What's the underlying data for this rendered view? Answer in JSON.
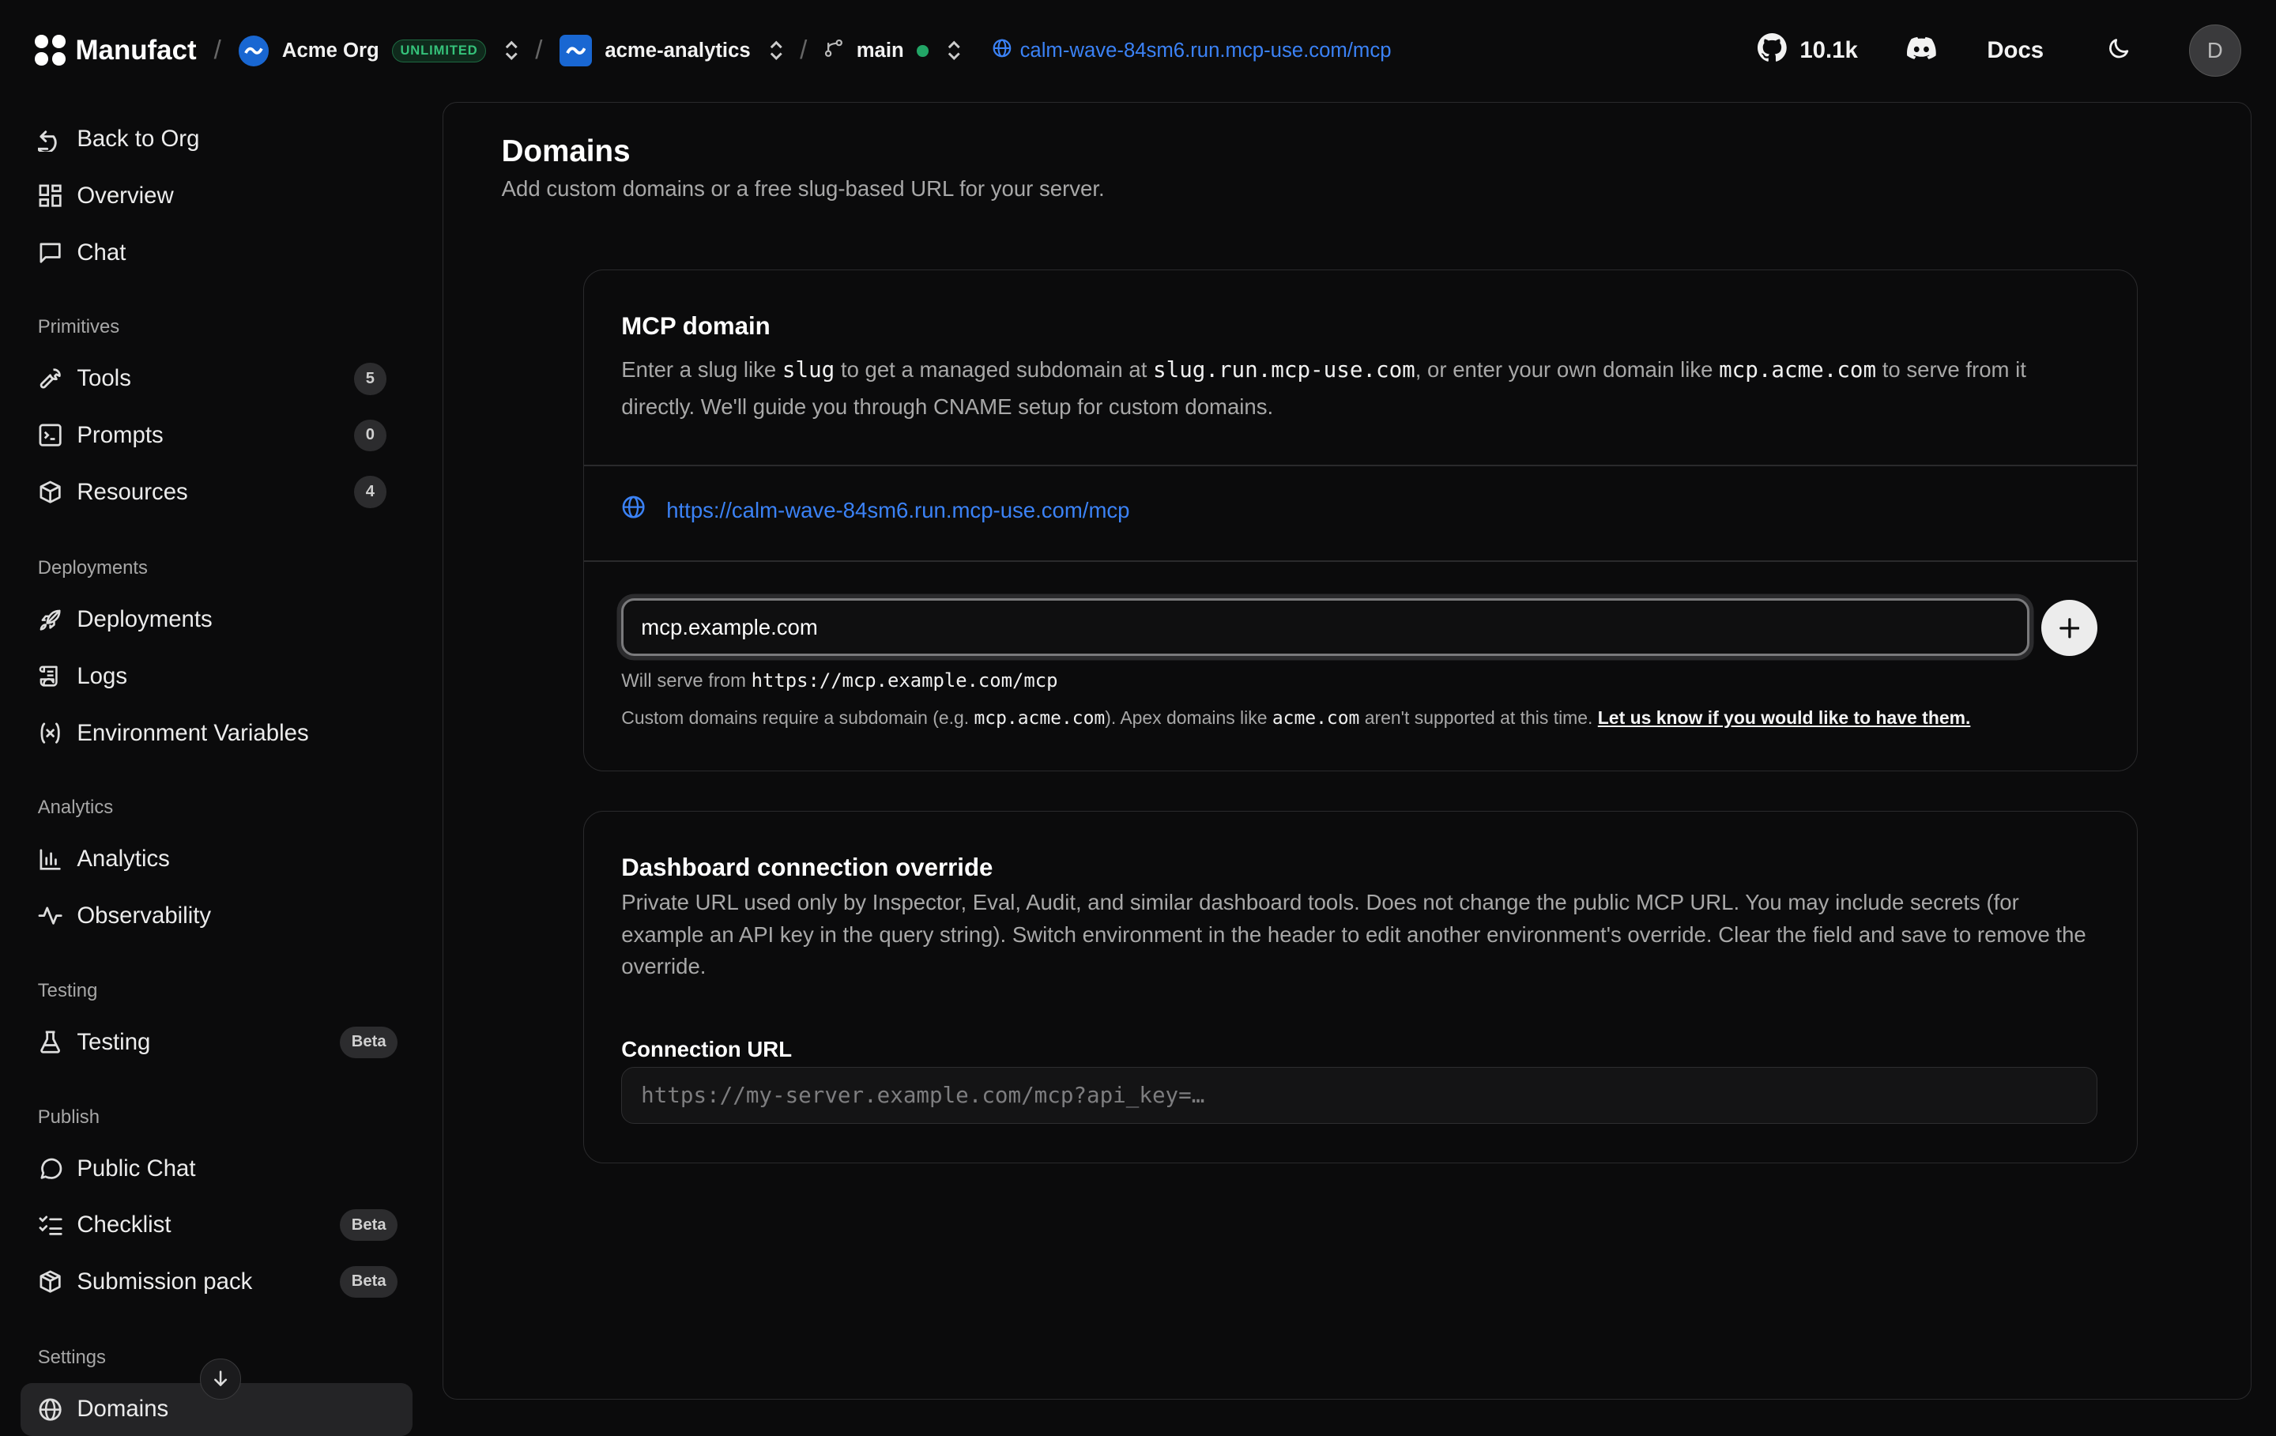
{
  "topbar": {
    "brand": "Manufact",
    "org": {
      "name": "Acme Org",
      "badge": "UNLIMITED"
    },
    "project": "acme-analytics",
    "branch": "main",
    "server_url": "calm-wave-84sm6.run.mcp-use.com/mcp",
    "github_stars": "10.1k",
    "docs_label": "Docs",
    "avatar_initial": "D"
  },
  "sidebar": {
    "back": "Back to Org",
    "overview": "Overview",
    "chat": "Chat",
    "sections": {
      "primitives": "Primitives",
      "deployments": "Deployments",
      "analytics": "Analytics",
      "testing": "Testing",
      "publish": "Publish",
      "settings": "Settings"
    },
    "items": {
      "tools": {
        "label": "Tools",
        "count": "5"
      },
      "prompts": {
        "label": "Prompts",
        "count": "0"
      },
      "resources": {
        "label": "Resources",
        "count": "4"
      },
      "deployments": "Deployments",
      "logs": "Logs",
      "env_vars": "Environment Variables",
      "analytics": "Analytics",
      "observability": "Observability",
      "testing": {
        "label": "Testing",
        "badge": "Beta"
      },
      "public_chat": "Public Chat",
      "checklist": {
        "label": "Checklist",
        "badge": "Beta"
      },
      "submission_pack": {
        "label": "Submission pack",
        "badge": "Beta"
      },
      "domains": "Domains"
    }
  },
  "main": {
    "title": "Domains",
    "subtitle": "Add custom domains or a free slug-based URL for your server.",
    "mcp_domain": {
      "heading": "MCP domain",
      "desc": {
        "p1": "Enter a slug like ",
        "c1": "slug",
        "p2": " to get a managed subdomain at ",
        "c2": "slug.run.mcp-use.com",
        "p3": ", or enter your own domain like ",
        "c3": "mcp.acme.com",
        "p4": " to serve from it directly. We'll guide you through CNAME setup for custom domains."
      },
      "current_url": "https://calm-wave-84sm6.run.mcp-use.com/mcp",
      "input_value": "mcp.example.com",
      "serve_prefix": "Will serve from ",
      "serve_url": "https://mcp.example.com/mcp",
      "note": {
        "p1": "Custom domains require a subdomain (e.g. ",
        "c1": "mcp.acme.com",
        "p2": "). Apex domains like ",
        "c2": "acme.com",
        "p3": " aren't supported at this time. ",
        "link": "Let us know if you would like to have them."
      }
    },
    "override": {
      "heading": "Dashboard connection override",
      "desc": "Private URL used only by Inspector, Eval, Audit, and similar dashboard tools. Does not change the public MCP URL. You may include secrets (for example an API key in the query string). Switch environment in the header to edit another environment's override. Clear the field and save to remove the override.",
      "field_label": "Connection URL",
      "placeholder": "https://my-server.example.com/mcp?api_key=…"
    }
  }
}
